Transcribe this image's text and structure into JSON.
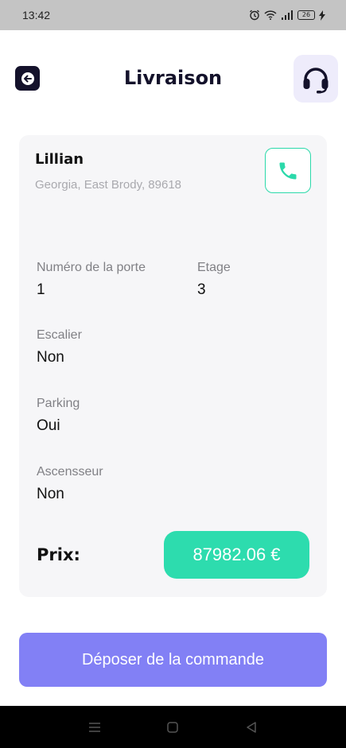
{
  "status_bar": {
    "time": "13:42",
    "battery_level": "26",
    "icons": [
      "alarm-icon",
      "wifi-icon",
      "signal-icon",
      "battery-icon",
      "charging-icon"
    ]
  },
  "header": {
    "title": "Livraison",
    "back_icon": "arrow-left-icon",
    "support_icon": "headset-icon"
  },
  "customer": {
    "name": "Lillian",
    "address": "Georgia, East Brody, 89618",
    "call_icon": "phone-icon"
  },
  "details": {
    "door_number": {
      "label": "Numéro de la porte",
      "value": "1"
    },
    "floor": {
      "label": "Etage",
      "value": "3"
    },
    "stairs": {
      "label": "Escalier",
      "value": "Non"
    },
    "parking": {
      "label": "Parking",
      "value": "Oui"
    },
    "elevator": {
      "label": "Ascensseur",
      "value": "Non"
    }
  },
  "price": {
    "label": "Prix:",
    "value": "87982.06 €"
  },
  "actions": {
    "submit_label": "Déposer de la commande"
  },
  "navigation_bar": {
    "keys": [
      "menu-icon",
      "home-icon",
      "back-triangle-icon"
    ]
  },
  "colors": {
    "accent_green": "#2ddcae",
    "primary_purple": "#8280f5",
    "dark_navy": "#14122b",
    "card_bg": "#f6f6f8"
  }
}
